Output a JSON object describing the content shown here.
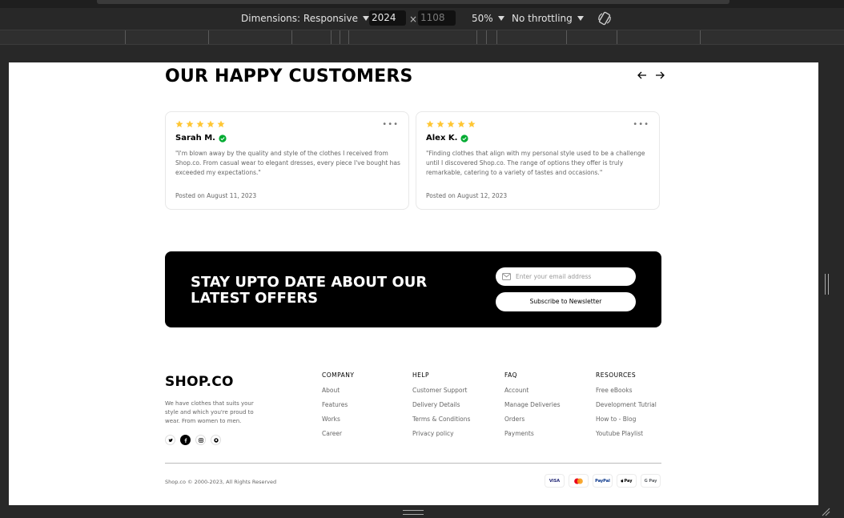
{
  "devtools": {
    "dimensions_label": "Dimensions: Responsive",
    "width_value": "2024",
    "height_placeholder": "1108",
    "times": "×",
    "zoom": "50%",
    "throttle": "No throttling"
  },
  "reviews": {
    "title": "OUR HAPPY CUSTOMERS",
    "items": [
      {
        "name": "Sarah M.",
        "text": "\"I'm blown away by the quality and style of the clothes I received from Shop.co. From casual wear to elegant dresses, every piece I've bought has exceeded my expectations.\"",
        "date": "Posted on August 11, 2023",
        "rating": 5
      },
      {
        "name": "Alex K.",
        "text": "\"Finding clothes that align with my personal style used to be a challenge until I discovered Shop.co. The range of options they offer is truly remarkable, catering to a variety of tastes and occasions.\"",
        "date": "Posted on August 12, 2023",
        "rating": 5
      }
    ],
    "more": "•••"
  },
  "newsletter": {
    "title": "STAY UPTO DATE ABOUT OUR LATEST OFFERS",
    "email_placeholder": "Enter your email address",
    "button_label": "Subscribe to Newsletter"
  },
  "footer": {
    "brand": "SHOP.CO",
    "description": "We have clothes that suits your style and which you're proud to wear. From women to men.",
    "columns": [
      {
        "heading": "COMPANY",
        "links": [
          "About",
          "Features",
          "Works",
          "Career"
        ]
      },
      {
        "heading": "HELP",
        "links": [
          "Customer Support",
          "Delivery Details",
          "Terms & Conditions",
          "Privacy policy"
        ]
      },
      {
        "heading": "FAQ",
        "links": [
          "Account",
          "Manage Deliveries",
          "Orders",
          "Payments"
        ]
      },
      {
        "heading": "RESOURCES",
        "links": [
          "Free eBooks",
          "Development Tutrial",
          "How to - Blog",
          "Youtube Playlist"
        ]
      }
    ],
    "copyright": "Shop.co © 2000-2023, All Rights Reserved",
    "payments": [
      "VISA",
      "PayPal",
      "Pay",
      "G Pay"
    ],
    "colors": {
      "star": "#FFC633",
      "verified": "#01AB31"
    }
  }
}
